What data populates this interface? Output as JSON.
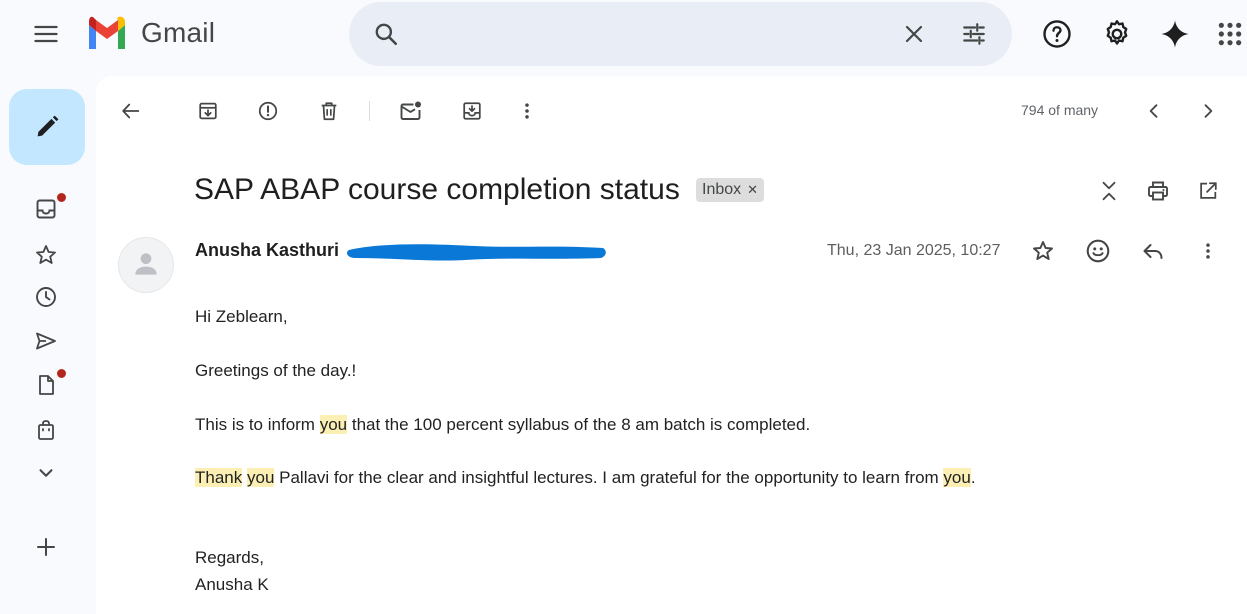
{
  "app": {
    "name": "Gmail"
  },
  "search": {
    "placeholder": "",
    "value": ""
  },
  "pager": {
    "text": "794 of many"
  },
  "email": {
    "subject": "SAP ABAP course completion status",
    "label_chip": "Inbox",
    "sender_name": "Anusha Kasthuri",
    "date": "Thu, 23 Jan 2025, 10:27",
    "body": {
      "greeting": "Hi Zeblearn,",
      "line1": "Greetings of the day.!",
      "line2": {
        "a": "This is to inform ",
        "b": "you",
        "c": " that the 100 percent syllabus of the 8 am batch is completed."
      },
      "line3": {
        "a": "Thank",
        "b": " ",
        "c": "you",
        "d": " Pallavi for the clear and insightful lectures. I am grateful for the opportunity to learn from ",
        "e": "you",
        "f": "."
      },
      "closing": "Regards,",
      "signature": "Anusha K"
    }
  },
  "colors": {
    "compose_bg": "#c2e7ff",
    "search_bg": "#e9eef6",
    "badge": "#b3261e",
    "highlight": "#fcefb4",
    "redaction": "#0a78d7"
  }
}
